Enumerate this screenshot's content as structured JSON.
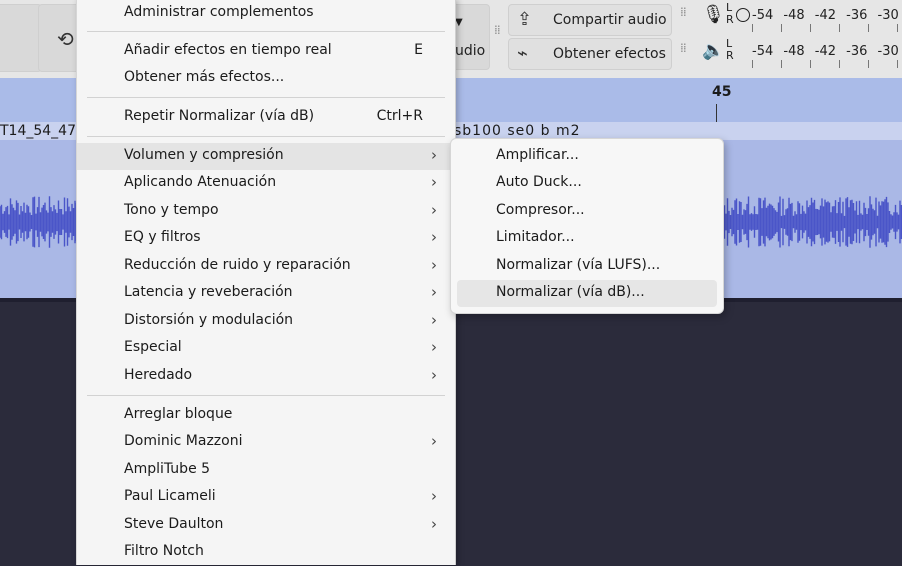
{
  "toolbar": {
    "audio_partial_label": "udio",
    "share_audio_label": "Compartir audio",
    "get_effects_label": "Obtener efectos",
    "meter_lr": [
      "L",
      "R"
    ],
    "meter_scale": [
      "-54",
      "-48",
      "-42",
      "-36",
      "-30"
    ]
  },
  "timeline": {
    "ruler_label": "45",
    "track_name_left": "T14_54_47",
    "track_name_right": "sb100 se0 b m2"
  },
  "menu": {
    "items": [
      {
        "label": "Administrar complementos"
      },
      {
        "label": "Añadir efectos en tiempo real",
        "shortcut": "E"
      },
      {
        "label": "Obtener más efectos..."
      },
      {
        "label": "Repetir Normalizar (vía dB)",
        "shortcut": "Ctrl+R"
      },
      {
        "label": "Volumen y compresión",
        "arrow": "›"
      },
      {
        "label": "Aplicando Atenuación",
        "arrow": "›"
      },
      {
        "label": "Tono y tempo",
        "arrow": "›"
      },
      {
        "label": "EQ y filtros",
        "arrow": "›"
      },
      {
        "label": "Reducción de ruido y reparación",
        "arrow": "›"
      },
      {
        "label": "Latencia y reveberación",
        "arrow": "›"
      },
      {
        "label": "Distorsión y modulación",
        "arrow": "›"
      },
      {
        "label": "Especial",
        "arrow": "›"
      },
      {
        "label": "Heredado",
        "arrow": "›"
      },
      {
        "label": "Arreglar bloque"
      },
      {
        "label": "Dominic Mazzoni",
        "arrow": "›"
      },
      {
        "label": "AmpliTube 5"
      },
      {
        "label": "Paul Licameli",
        "arrow": "›"
      },
      {
        "label": "Steve Daulton",
        "arrow": "›"
      },
      {
        "label": "Filtro Notch"
      }
    ]
  },
  "submenu": {
    "items": [
      {
        "label": "Amplificar..."
      },
      {
        "label": "Auto Duck..."
      },
      {
        "label": "Compresor..."
      },
      {
        "label": "Limitador..."
      },
      {
        "label": "Normalizar (vía LUFS)..."
      },
      {
        "label": "Normalizar (vía dB)..."
      }
    ]
  },
  "colors": {
    "waveform": "#4a55c8",
    "track_bg": "#aab8e6",
    "highlight": "#e4e4e4"
  }
}
